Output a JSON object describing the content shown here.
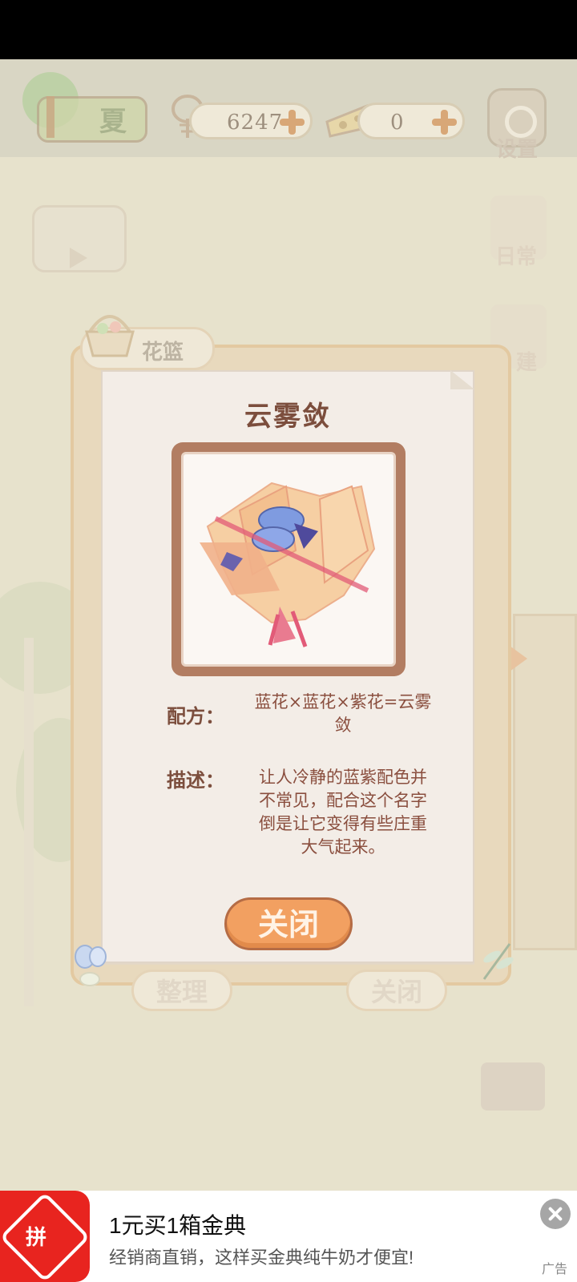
{
  "hud": {
    "logo_char": "夏",
    "fishbone_count": "6247",
    "cheese_count": "0",
    "settings_label": "设置"
  },
  "side_menu": {
    "daily_label": "日常",
    "build_label": "建"
  },
  "panel": {
    "tab_label": "花篮",
    "item_name": "云雾敛",
    "recipe_label": "配方：",
    "recipe_text_line1": "蓝花×蓝花×紫花=云雾",
    "recipe_text_line2": "敛",
    "desc_label": "描述：",
    "desc_lines": [
      "让人冷静的蓝紫配色并",
      "不常见，配合这个名字",
      "倒是让它变得有些庄重",
      "大气起来。"
    ],
    "close_button": "关闭"
  },
  "bottom_buttons": {
    "sort_label": "整理",
    "close_label": "关闭"
  },
  "ad": {
    "logo_text": "拼",
    "title": "1元买1箱金典",
    "subtitle": "经销商直销，这样买金典纯牛奶才便宜!",
    "tag": "广告"
  },
  "colors": {
    "accent_orange": "#f2a061",
    "title_brown": "#7c4e3d",
    "paper": "#f3ede7",
    "ad_red": "#e8241f"
  },
  "icons": [
    "fishbone-icon",
    "cheese-icon",
    "plus-icon",
    "gear-icon",
    "video-play-icon",
    "basket-icon",
    "flower-bouquet",
    "butterfly-icon",
    "dragonfly-icon",
    "close-icon",
    "arrow-right-icon"
  ]
}
